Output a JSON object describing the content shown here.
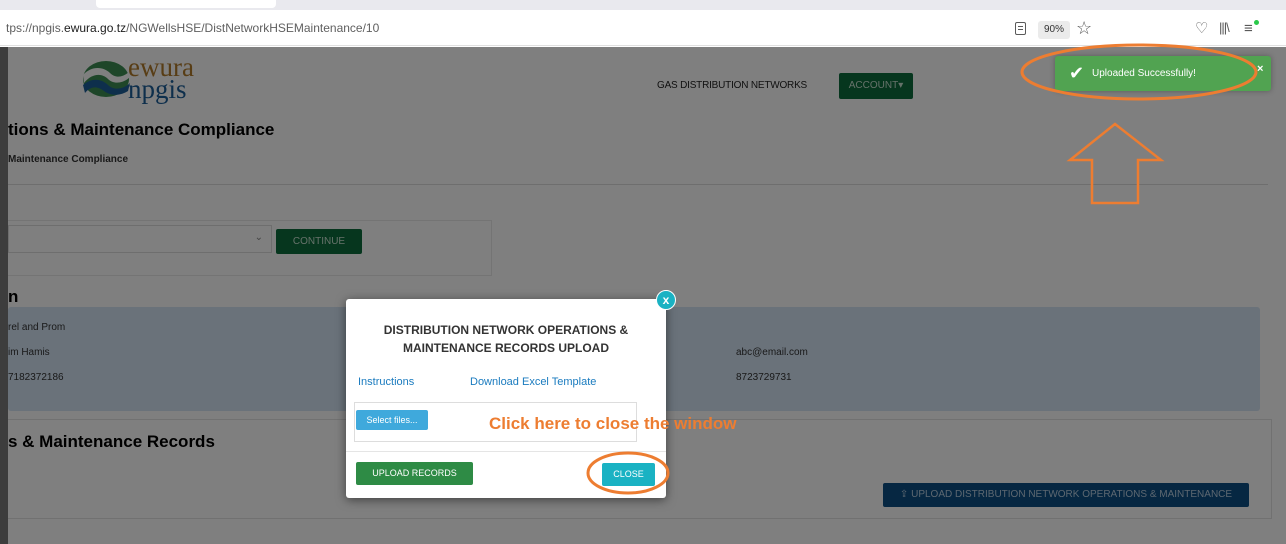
{
  "browser": {
    "url_prefix": "tps://npgis.",
    "url_domain": "ewura.go.tz",
    "url_path": "/NGWellsHSE/DistNetworkHSEMaintenance/10",
    "zoom": "90%",
    "icons": [
      "reader-view-icon",
      "star-icon",
      "pocket-icon",
      "library-icon",
      "menu-icon"
    ]
  },
  "header": {
    "logo_top": "ewura",
    "logo_bottom": "npgis",
    "nav_gas": "GAS DISTRIBUTION NETWORKS",
    "nav_account": "ACCOUNT"
  },
  "page": {
    "title": "tions & Maintenance Compliance",
    "breadcrumb": "Maintenance Compliance",
    "continue_label": "CONTINUE",
    "section_n": "n",
    "info": {
      "name": "rel and Prom",
      "person": "im Hamis",
      "phone": "7182372186",
      "email": "abc@email.com",
      "phone2": "8723729731"
    },
    "records_title": "s & Maintenance Records",
    "upload_ops_label": "UPLOAD DISTRIBUTION NETWORK OPERATIONS & MAINTENANCE"
  },
  "modal": {
    "title_line1": "DISTRIBUTION NETWORK OPERATIONS &",
    "title_line2": "MAINTENANCE RECORDS UPLOAD",
    "instructions_label": "Instructions",
    "download_label": "Download Excel Template",
    "select_files_label": "Select files...",
    "upload_records_label": "UPLOAD RECORDS",
    "close_label": "CLOSE",
    "close_x": "x"
  },
  "annotation": {
    "text": "Click here to close the window",
    "color": "#ed7d31"
  },
  "toast": {
    "message": "Uploaded Successfully!",
    "close": "×",
    "color": "#51a351"
  }
}
